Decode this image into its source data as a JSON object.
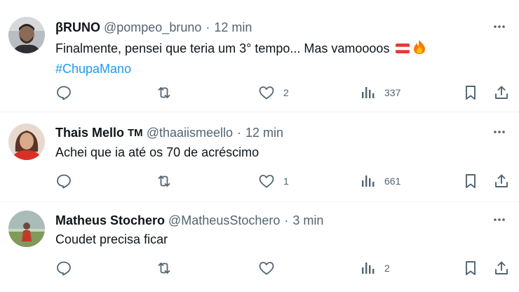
{
  "tweets": [
    {
      "author": "βRUNO",
      "badge": "",
      "handle": "@pompeo_bruno",
      "separator": "·",
      "time": "12 min",
      "text": "Finalmente, pensei que teria um 3° tempo... Mas vamoooos",
      "emojis": [
        "flag-icon",
        "fire-icon"
      ],
      "hashtag": "#ChupaMano",
      "likes": "2",
      "views": "337"
    },
    {
      "author": "Thais Mello",
      "badge": "TM",
      "handle": "@thaaiismeello",
      "separator": "·",
      "time": "12 min",
      "text": "Achei que ia até os 70 de acréscimo",
      "hashtag": "",
      "likes": "1",
      "views": "661"
    },
    {
      "author": "Matheus Stochero",
      "badge": "",
      "handle": "@MatheusStochero",
      "separator": "·",
      "time": "3 min",
      "text": "Coudet precisa ficar",
      "hashtag": "",
      "likes": "",
      "views": "2"
    }
  ],
  "colors": {
    "text": "#0f1419",
    "secondary": "#536471",
    "link": "#1d9bf0",
    "divider": "#eff3f4"
  },
  "icons": [
    "reply-icon",
    "retweet-icon",
    "like-icon",
    "views-icon",
    "bookmark-icon",
    "share-icon",
    "more-icon"
  ]
}
